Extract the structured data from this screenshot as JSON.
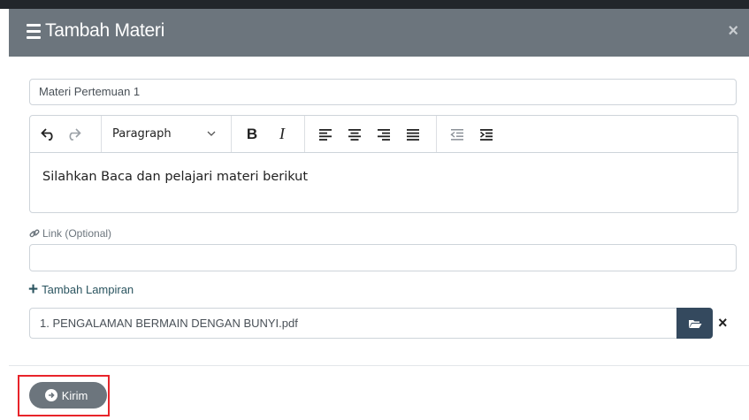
{
  "modal": {
    "title": "Tambah Materi",
    "close_label": "×"
  },
  "form": {
    "title_value": "Materi Pertemuan 1",
    "editor": {
      "block_format": "Paragraph",
      "bold_label": "B",
      "italic_label": "I",
      "content": "Silahkan Baca dan pelajari materi berikut"
    },
    "link_label": "Link (Optional)",
    "link_value": "",
    "add_attachment_label": "Tambah Lampiran",
    "attachment_filename": "1. PENGALAMAN BERMAIN DENGAN BUNYI.pdf",
    "remove_label": "×"
  },
  "footer": {
    "submit_label": "Kirim"
  },
  "colors": {
    "header_bg": "#6c757d",
    "browse_button": "#34495e",
    "highlight_border": "#e8242a"
  }
}
